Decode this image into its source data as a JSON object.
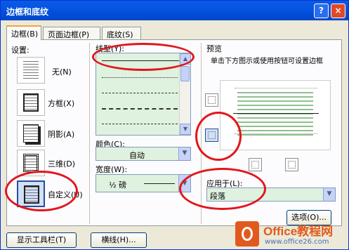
{
  "window": {
    "title": "边框和底纹",
    "help": "?",
    "close": "×"
  },
  "tabs": [
    {
      "label": "边框(B)",
      "active": true
    },
    {
      "label": "页面边框(P)",
      "active": false
    },
    {
      "label": "底纹(S)",
      "active": false
    }
  ],
  "settings": {
    "heading": "设置:",
    "items": [
      {
        "label": "无(N)",
        "icon": "setting-none-icon"
      },
      {
        "label": "方框(X)",
        "icon": "setting-box-icon"
      },
      {
        "label": "阴影(A)",
        "icon": "setting-shadow-icon"
      },
      {
        "label": "三维(D)",
        "icon": "setting-3d-icon"
      },
      {
        "label": "自定义(U)",
        "icon": "setting-custom-icon",
        "selected": true
      }
    ]
  },
  "style": {
    "heading": "线型(Y):",
    "color_label": "颜色(C):",
    "color_value": "自动",
    "width_label": "宽度(W):",
    "width_value": "½ 磅"
  },
  "preview": {
    "heading": "预览",
    "hint": "单击下方图示或使用按钮可设置边框",
    "apply_label": "应用于(L):",
    "apply_value": "段落",
    "options_button": "选项(O)..."
  },
  "footer": {
    "toolbar_button": "显示工具栏(T)",
    "hline_button": "横线(H)..."
  },
  "watermark": {
    "brand": "Office教程网",
    "url": "www.office26.com"
  },
  "colors": {
    "title_bar": "#0554e3",
    "dialog_bg": "#ece9d8",
    "list_bg": "#dff1df",
    "highlight": "#e2161b"
  }
}
